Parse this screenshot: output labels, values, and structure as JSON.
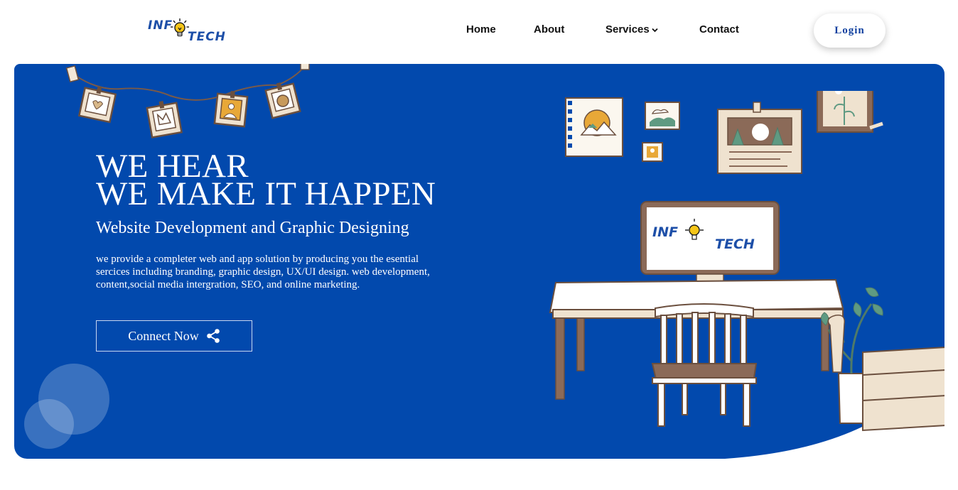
{
  "header": {
    "logo": {
      "word_left": "INF",
      "word_right": "TECH",
      "icon": "lightbulb-icon"
    },
    "nav": [
      {
        "label": "Home"
      },
      {
        "label": "About"
      },
      {
        "label": "Services",
        "icon": "chevron-down-icon"
      },
      {
        "label": "Contact"
      }
    ],
    "login_label": "Login"
  },
  "hero": {
    "headline_line1": "WE HEAR",
    "headline_line2": "WE MAKE IT HAPPEN",
    "subheadline": "Website Development and Graphic Designing",
    "description": "we provide a completer web and app solution by producing you the esential sercices including branding, graphic design, UX/UI design. web development, content,social media intergration, SEO, and online marketing.",
    "cta_label": "Connect Now",
    "cta_icon": "share-icon",
    "screen_logo": {
      "word_left": "INF",
      "word_right": "TECH"
    }
  },
  "colors": {
    "hero_background": "#0249ad",
    "brand_blue": "#1d4fa8",
    "login_text": "#0e3f9f",
    "bulb_yellow": "#f5c518"
  }
}
